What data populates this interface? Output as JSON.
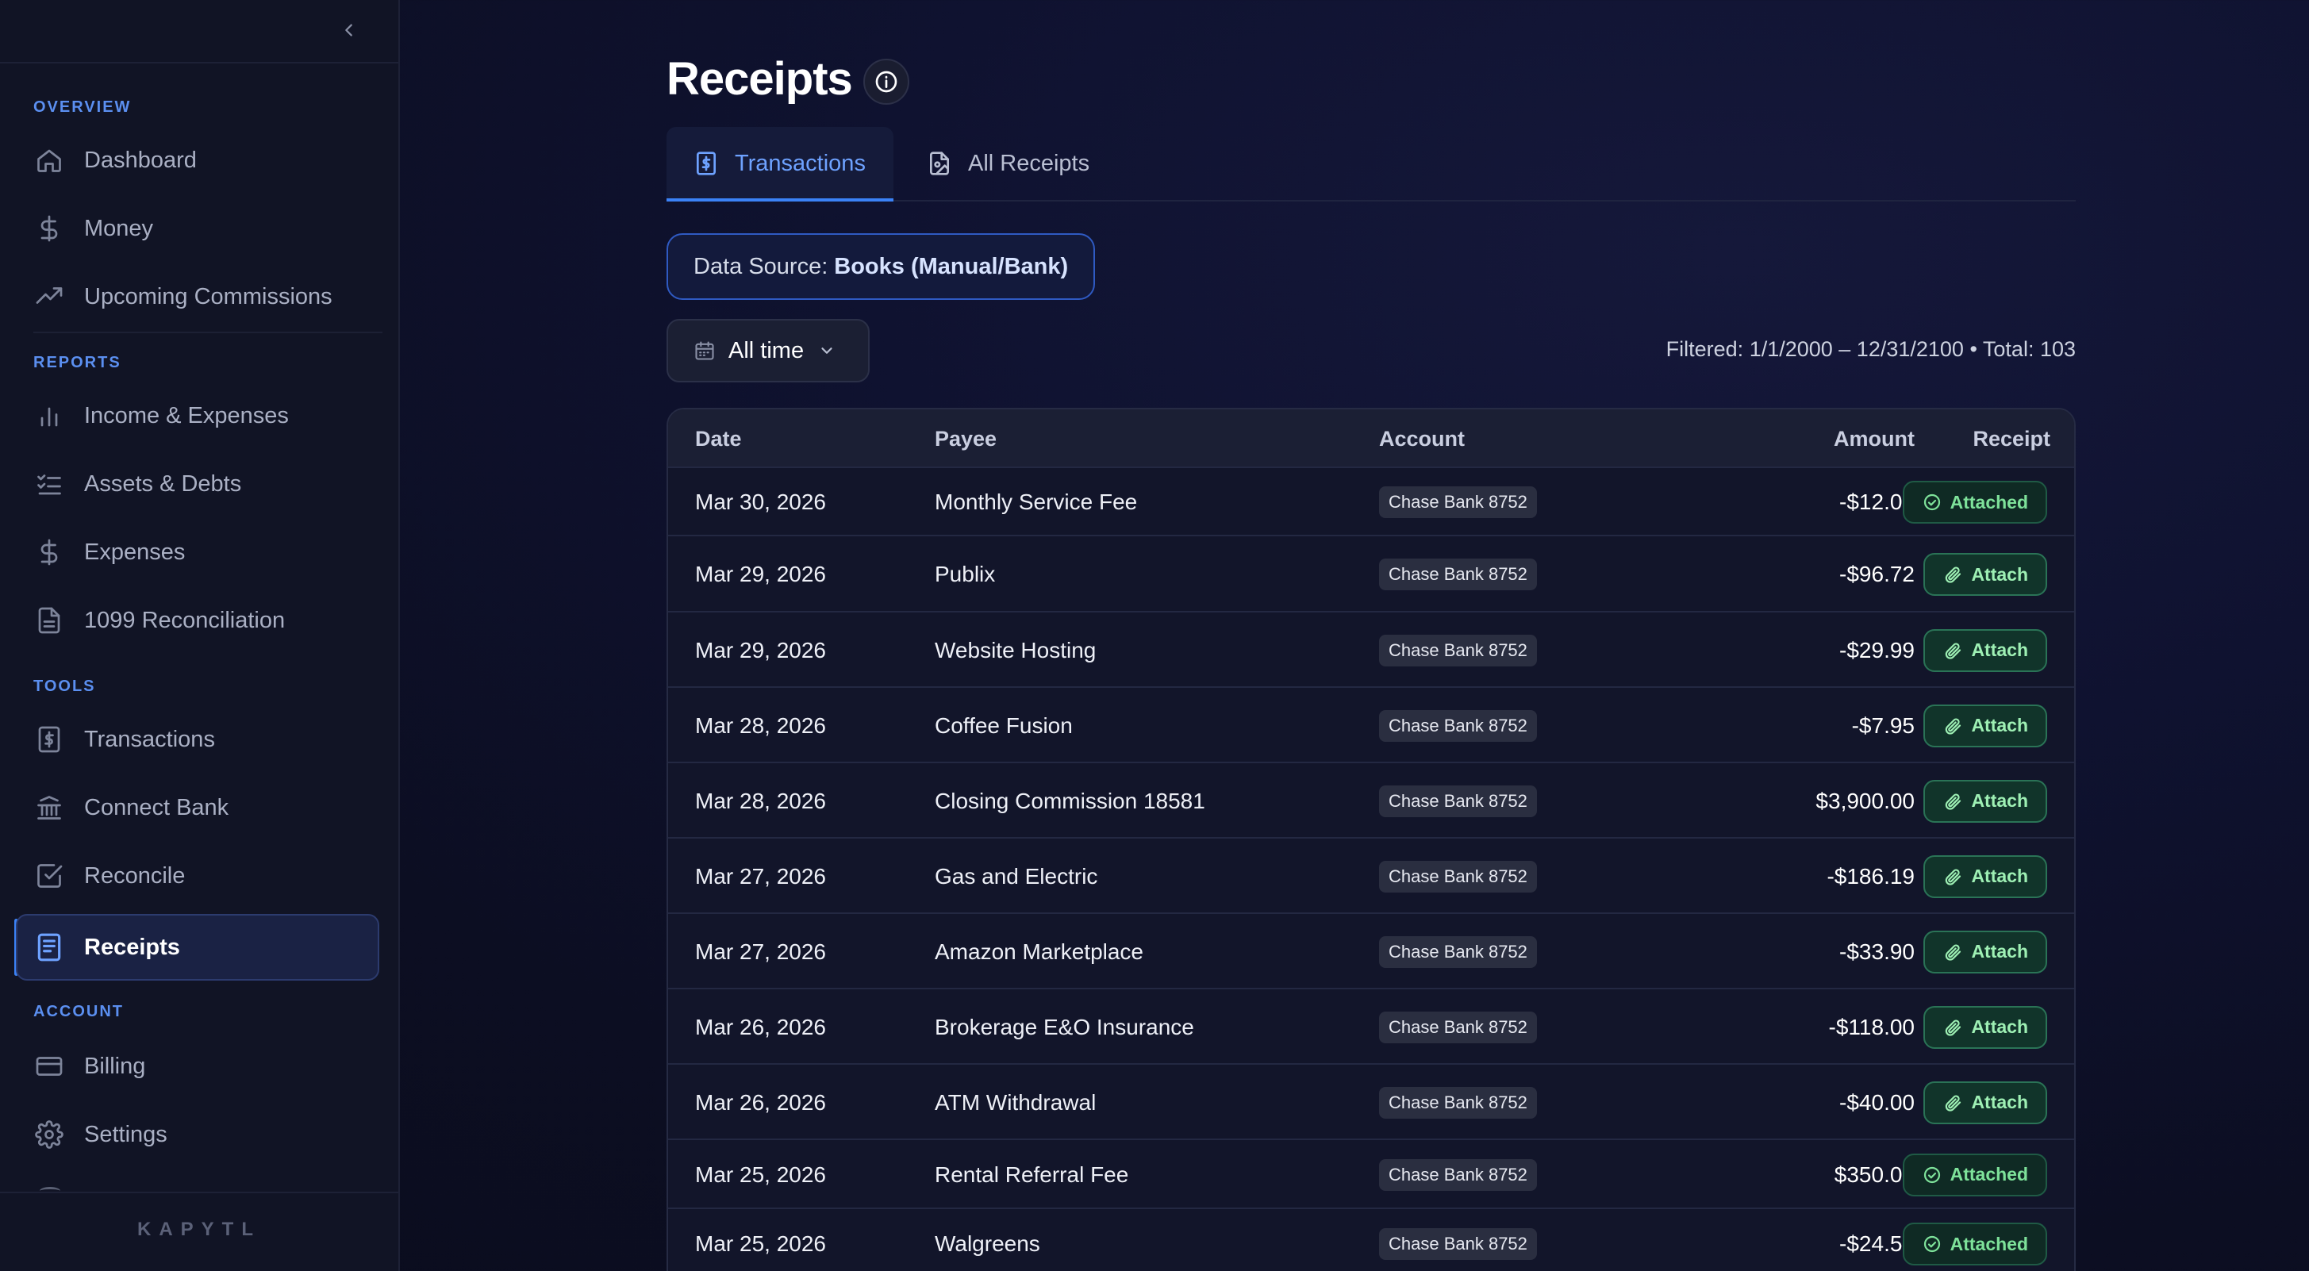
{
  "sidebar": {
    "sections": {
      "overview": "OVERVIEW",
      "reports": "REPORTS",
      "tools": "TOOLS",
      "account": "ACCOUNT"
    },
    "items": {
      "dashboard": "Dashboard",
      "money": "Money",
      "upcoming_commissions": "Upcoming Commissions",
      "income_expenses": "Income & Expenses",
      "assets_debts": "Assets & Debts",
      "expenses": "Expenses",
      "reconciliation_1099": "1099 Reconciliation",
      "transactions": "Transactions",
      "connect_bank": "Connect Bank",
      "reconcile": "Reconcile",
      "receipts": "Receipts",
      "billing": "Billing",
      "settings": "Settings"
    },
    "active_item": "receipts",
    "brand": "KAPYTL"
  },
  "page": {
    "title": "Receipts"
  },
  "tabs": [
    {
      "label": "Transactions",
      "active": true
    },
    {
      "label": "All Receipts",
      "active": false
    }
  ],
  "data_source": {
    "prefix": "Data Source:",
    "value": "Books (Manual/Bank)"
  },
  "date_filter": {
    "label": "All time"
  },
  "filter_summary": "Filtered: 1/1/2000 – 12/31/2100 • Total: 103",
  "table": {
    "headers": {
      "date": "Date",
      "payee": "Payee",
      "account": "Account",
      "amount": "Amount",
      "receipt": "Receipt"
    },
    "rows": [
      {
        "date": "Mar 30, 2026",
        "payee": "Monthly Service Fee",
        "account": "Chase Bank 8752",
        "amount": "-$12.00",
        "receipt": "Attached"
      },
      {
        "date": "Mar 29, 2026",
        "payee": "Publix",
        "account": "Chase Bank 8752",
        "amount": "-$96.72",
        "receipt": "Attach"
      },
      {
        "date": "Mar 29, 2026",
        "payee": "Website Hosting",
        "account": "Chase Bank 8752",
        "amount": "-$29.99",
        "receipt": "Attach"
      },
      {
        "date": "Mar 28, 2026",
        "payee": "Coffee Fusion",
        "account": "Chase Bank 8752",
        "amount": "-$7.95",
        "receipt": "Attach"
      },
      {
        "date": "Mar 28, 2026",
        "payee": "Closing Commission 18581",
        "account": "Chase Bank 8752",
        "amount": "$3,900.00",
        "receipt": "Attach"
      },
      {
        "date": "Mar 27, 2026",
        "payee": "Gas and Electric",
        "account": "Chase Bank 8752",
        "amount": "-$186.19",
        "receipt": "Attach"
      },
      {
        "date": "Mar 27, 2026",
        "payee": "Amazon Marketplace",
        "account": "Chase Bank 8752",
        "amount": "-$33.90",
        "receipt": "Attach"
      },
      {
        "date": "Mar 26, 2026",
        "payee": "Brokerage E&O Insurance",
        "account": "Chase Bank 8752",
        "amount": "-$118.00",
        "receipt": "Attach"
      },
      {
        "date": "Mar 26, 2026",
        "payee": "ATM Withdrawal",
        "account": "Chase Bank 8752",
        "amount": "-$40.00",
        "receipt": "Attach"
      },
      {
        "date": "Mar 25, 2026",
        "payee": "Rental Referral Fee",
        "account": "Chase Bank 8752",
        "amount": "$350.00",
        "receipt": "Attached"
      },
      {
        "date": "Mar 25, 2026",
        "payee": "Walgreens",
        "account": "Chase Bank 8752",
        "amount": "-$24.53",
        "receipt": "Attached"
      }
    ]
  },
  "colors": {
    "accent": "#3b82f6",
    "attached_text": "#7ee29a",
    "section_label": "#5b8ff0"
  }
}
